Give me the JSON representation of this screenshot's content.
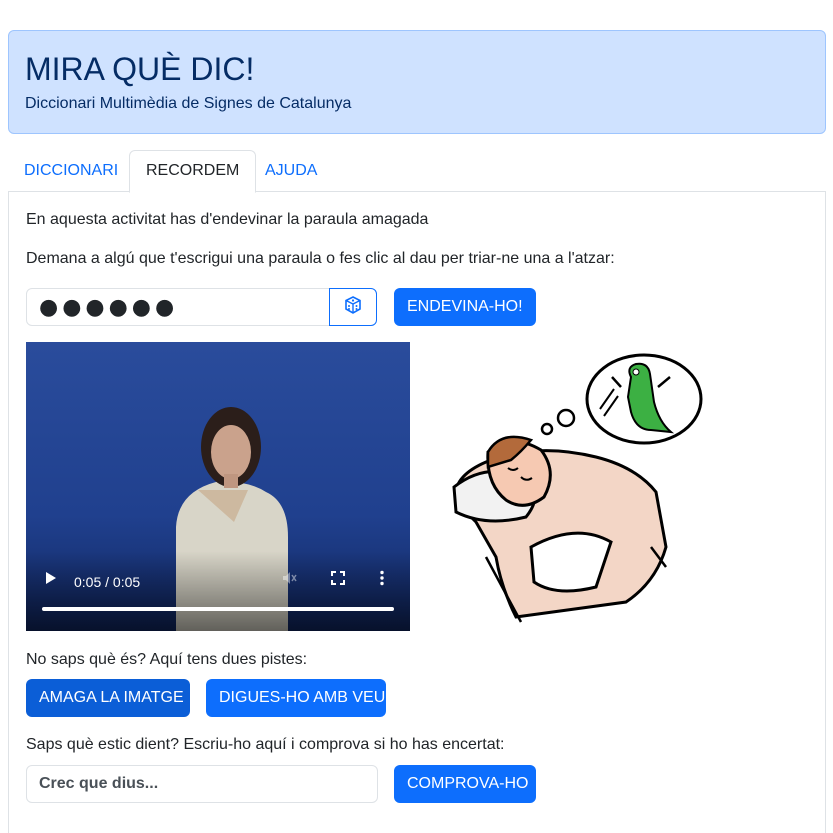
{
  "header": {
    "title": "MIRA QUÈ DIC!",
    "subtitle": "Diccionari Multimèdia de Signes de Catalunya"
  },
  "tabs": [
    {
      "label": "DICCIONARI"
    },
    {
      "label": "RECORDEM",
      "active": true
    },
    {
      "label": "AJUDA"
    }
  ],
  "main": {
    "intro": "En aquesta activitat has d'endevinar la paraula amagada",
    "instruction": "Demana a algú que t'escrigui una paraula o fes clic al dau per triar-ne una a l'atzar:",
    "secret_word_value": "●●●●●●",
    "guess_button": "ENDEVINA-HO!",
    "video": {
      "time": "0:05 / 0:05",
      "progress": 1.0
    },
    "hints_text": "No saps què és? Aquí tens dues pistes:",
    "hide_image_button": "AMAGA LA IMATGE",
    "say_it_button": "DIGUES-HO AMB VEU",
    "check_text": "Saps què estic dient? Escriu-ho aquí i comprova si ho has encertat:",
    "answer_placeholder": "Crec que dius...",
    "check_button": "COMPROVA-HO"
  },
  "icons": {
    "dice": "dice-icon",
    "play": "play-icon",
    "mute": "volume-mute-icon",
    "fullscreen": "fullscreen-icon",
    "more": "more-vertical-icon"
  },
  "colors": {
    "primary": "#0d6efd",
    "header_bg": "#cfe2ff",
    "header_text": "#052c65"
  }
}
